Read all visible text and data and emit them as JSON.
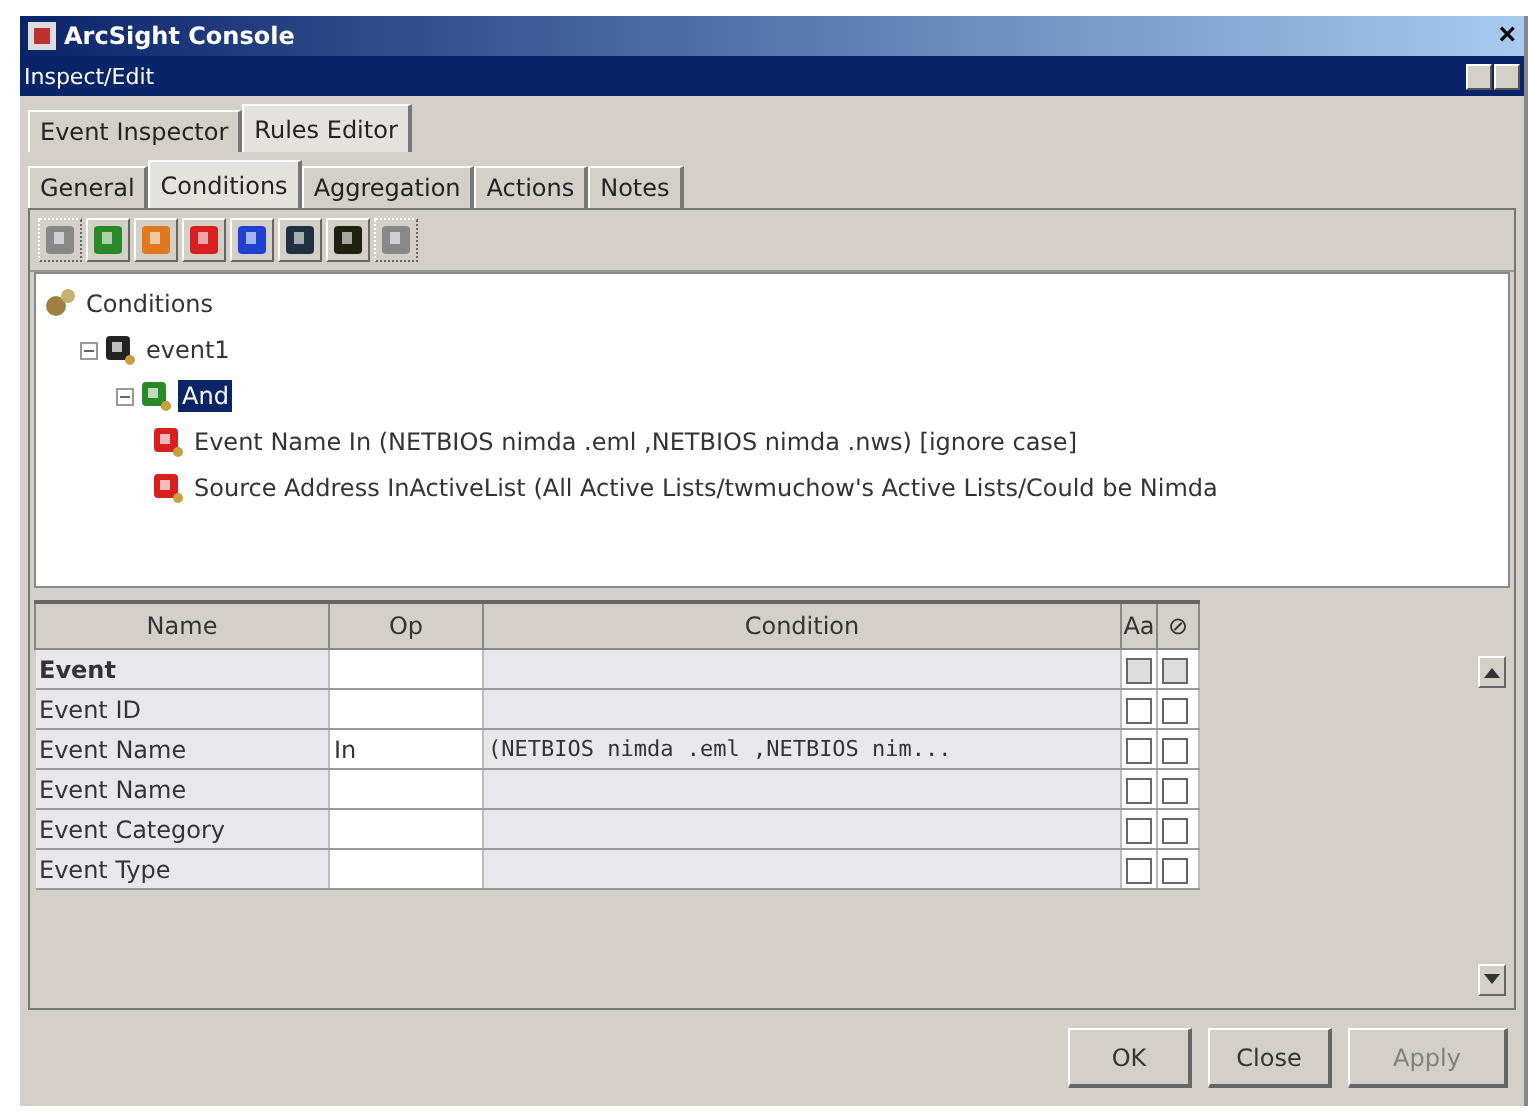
{
  "window": {
    "title": "ArcSight Console",
    "close": "×"
  },
  "subtitle_bar": {
    "title": "Inspect/Edit"
  },
  "outer_tabs": [
    {
      "label": "Event Inspector",
      "selected": false
    },
    {
      "label": "Rules Editor",
      "selected": true
    }
  ],
  "inner_tabs": [
    {
      "label": "General",
      "selected": false
    },
    {
      "label": "Conditions",
      "selected": true
    },
    {
      "label": "Aggregation",
      "selected": false
    },
    {
      "label": "Actions",
      "selected": false
    },
    {
      "label": "Notes",
      "selected": false
    }
  ],
  "toolbar": [
    {
      "color": "#888888",
      "disabled": true
    },
    {
      "color": "#2a8a2a",
      "disabled": false
    },
    {
      "color": "#e07820",
      "disabled": false
    },
    {
      "color": "#d82020",
      "disabled": false
    },
    {
      "color": "#2040d0",
      "disabled": false
    },
    {
      "color": "#203040",
      "disabled": false
    },
    {
      "color": "#202010",
      "disabled": false
    },
    {
      "color": "#888888",
      "disabled": true
    }
  ],
  "tree": {
    "label": "Conditions",
    "kind": "root",
    "children": [
      {
        "label": "event1",
        "kind": "event",
        "expanded": true,
        "selected": false,
        "children": [
          {
            "label": "And",
            "kind": "and",
            "expanded": true,
            "selected": true,
            "children": [
              {
                "label": "Event Name In (NETBIOS nimda .eml ,NETBIOS nimda .nws) [ignore case]",
                "kind": "condition",
                "selected": false
              },
              {
                "label": "Source Address InActiveList (All Active Lists/twmuchow's Active Lists/Could be Nimda",
                "kind": "condition",
                "selected": false
              }
            ]
          }
        ]
      }
    ]
  },
  "table": {
    "columns": [
      "Name",
      "Op",
      "Condition",
      "Aa",
      "⊘"
    ],
    "rows": [
      {
        "kind": "group",
        "name": "Event",
        "op": "",
        "condition": "",
        "case": false,
        "negate": false,
        "disabled": true
      },
      {
        "kind": "field",
        "name": "Event ID",
        "op": "",
        "condition": "",
        "case": false,
        "negate": false,
        "disabled": false
      },
      {
        "kind": "field",
        "name": "Event Name",
        "op": "In",
        "condition": "(NETBIOS nimda .eml ,NETBIOS nim...",
        "case": false,
        "negate": false,
        "disabled": false
      },
      {
        "kind": "field",
        "name": "Event Name",
        "op": "",
        "condition": "",
        "case": false,
        "negate": false,
        "disabled": false
      },
      {
        "kind": "field",
        "name": "Event Category",
        "op": "",
        "condition": "",
        "case": false,
        "negate": false,
        "disabled": false
      },
      {
        "kind": "field",
        "name": "Event Type",
        "op": "",
        "condition": "",
        "case": false,
        "negate": false,
        "disabled": false
      }
    ]
  },
  "buttons": [
    {
      "label": "OK",
      "disabled": false
    },
    {
      "label": "Close",
      "disabled": false
    },
    {
      "label": "Apply",
      "disabled": true
    }
  ]
}
